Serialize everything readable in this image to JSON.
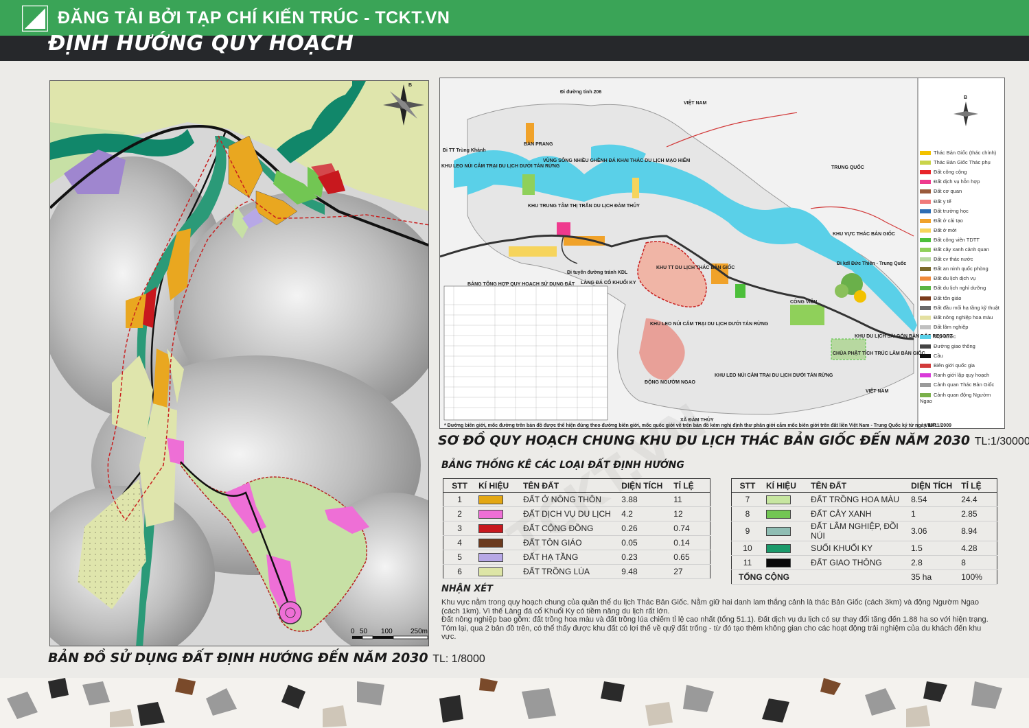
{
  "banner": {
    "text": "ĐĂNG TẢI BỞI TẠP CHÍ KIẾN TRÚC - TCKT.VN"
  },
  "page_title": "ĐỊNH HƯỚNG QUY HOẠCH",
  "left_map": {
    "caption": "BẢN ĐỒ SỬ DỤNG ĐẤT ĐỊNH HƯỚNG ĐẾN NĂM 2030",
    "scale_text": "TL: 1/8000",
    "north": "B",
    "scale_labels": [
      "0",
      "50",
      "100",
      "250m"
    ]
  },
  "right_map": {
    "caption": "SƠ ĐỒ QUY HOẠCH CHUNG KHU DU LỊCH THÁC BẢN GIỐC ĐẾN NĂM 2030",
    "scale_text": "TL:1/30000",
    "north": "B",
    "labels": {
      "road206": "Đi đường tỉnh 206",
      "vn1": "VIỆT NAM",
      "vn2": "VIỆT NAM",
      "cn": "TRUNG QUỐC",
      "trungkhanh": "Đi TT Trùng Khánh",
      "banprang": "BẢN PRANG",
      "zone1": "VÙNG SÔNG NHIỀU GHỀNH ĐÁ KHAI THÁC DU LỊCH MẠO HIỂM",
      "camp1": "KHU LEO NÚI CẮM TRẠI DU LỊCH DƯỚI TÁN RỪNG",
      "center": "KHU TRUNG TÂM THỊ TRẤN DU LỊCH ĐÀM THỦY",
      "thac": "KHU VỰC THÁC BẢN GIỐC",
      "ductien": "Đi kdl Đức Thiên - Trung Quốc",
      "khutt": "KHU TT DU LỊCH THÁC BẢN GIỐC",
      "congvien": "CÔNG VIÊN",
      "village": "LÀNG ĐÁ CỔ KHUỔI KY",
      "bypass": "Đi tuyến đường tránh KDL",
      "camp2": "KHU LEO NÚI CẮM TRẠI DU LỊCH DƯỚI TÁN RỪNG",
      "camp3": "KHU LEO NÚI CẮM TRẠI DU LỊCH DƯỚI TÁN RỪNG",
      "cave": "ĐỘNG NGƯỜM NGAO",
      "pagoda": "CHÙA PHẬT TÍCH TRÚC LÂM BẢN GIỐC",
      "resort": "KHU DU LỊCH SÀI GÒN BẢN ĐỐC RESORT",
      "xa": "XÃ ĐÀM THỦY",
      "table_title": "BẢNG TỔNG HỢP QUY HOẠCH SỬ DỤNG ĐẤT",
      "footnote": "* Đường biên giới, mốc đường trên bản đồ được thể hiện đúng theo đường biên giới, mốc quốc giới về trên bản đồ kèm nghị định thư phân giới cắm mốc biên giới trên đất liền Việt Nam - Trung Quốc ký từ ngày 18/11/2009",
      "logo": "VIUP"
    },
    "legend": [
      {
        "label": "Thác Bản Giốc (thác chính)",
        "color": "#f3c200"
      },
      {
        "label": "Thác Bản Giốc Thác phụ",
        "color": "#c9d44a"
      },
      {
        "label": "Đất công cộng",
        "color": "#e8242a"
      },
      {
        "label": "Đất dịch vụ hỗn hợp",
        "color": "#ef3a8e"
      },
      {
        "label": "Đất cơ quan",
        "color": "#9a5a3b"
      },
      {
        "label": "Đất y tế",
        "color": "#f07b7b"
      },
      {
        "label": "Đất trường học",
        "color": "#2d6db3"
      },
      {
        "label": "Đất ở cải tạo",
        "color": "#f0a22a"
      },
      {
        "label": "Đất ở mới",
        "color": "#f6d45c"
      },
      {
        "label": "Đất công viên TDTT",
        "color": "#4cbf3a"
      },
      {
        "label": "Đất cây xanh cảnh quan",
        "color": "#8fd05a"
      },
      {
        "label": "Đất cv thác nước",
        "color": "#b7d8a0"
      },
      {
        "label": "Đất an ninh quốc phòng",
        "color": "#7b6a2a"
      },
      {
        "label": "Đất du lịch dịch vụ",
        "color": "#f08a3a"
      },
      {
        "label": "Đất du lịch nghỉ dưỡng",
        "color": "#5bb544"
      },
      {
        "label": "Đất tôn giáo",
        "color": "#7a3a1a"
      },
      {
        "label": "Đất đầu mối hạ tầng kỹ thuật",
        "color": "#6a6a6a"
      },
      {
        "label": "Đất nông nghiệp hoa màu",
        "color": "#e4e0a0"
      },
      {
        "label": "Đất lâm nghiệp",
        "color": "#c0c0c0"
      },
      {
        "label": "Mặt nước",
        "color": "#5ad0e8"
      },
      {
        "label": "Đường giao thông",
        "color": "#444444"
      },
      {
        "label": "Cầu",
        "color": "#111111"
      },
      {
        "label": "Biên giới quốc gia",
        "color": "#d23a3a"
      },
      {
        "label": "Ranh giới lập quy hoạch",
        "color": "#d93ad9"
      },
      {
        "label": "Cảnh quan Thác Bản Giốc",
        "color": "#9a9a9a"
      },
      {
        "label": "Cảnh quan động Ngườm Ngao",
        "color": "#7ab04a"
      }
    ]
  },
  "stats": {
    "title": "BẢNG THỐNG KÊ CÁC LOẠI ĐẤT ĐỊNH HƯỚNG",
    "headers": [
      "STT",
      "KÍ HIỆU",
      "TÊN ĐẤT",
      "DIỆN TÍCH",
      "TỈ LỆ"
    ],
    "left_rows": [
      {
        "stt": "1",
        "name": "ĐẤT Ở NÔNG THÔN",
        "area": "3.88",
        "ratio": "11",
        "color": "#e3a713"
      },
      {
        "stt": "2",
        "name": "ĐẤT DỊCH VỤ DU LỊCH",
        "area": "4.2",
        "ratio": "12",
        "color": "#ee6fd6"
      },
      {
        "stt": "3",
        "name": "ĐẤT CỘNG ĐỒNG",
        "area": "0.26",
        "ratio": "0.74",
        "color": "#c8181e"
      },
      {
        "stt": "4",
        "name": "ĐẤT TÔN GIÁO",
        "area": "0.05",
        "ratio": "0.14",
        "color": "#6b3a1e"
      },
      {
        "stt": "5",
        "name": "ĐẤT HẠ TẦNG",
        "area": "0.23",
        "ratio": "0.65",
        "color": "#b7a8e6"
      },
      {
        "stt": "6",
        "name": "ĐẤT TRỒNG LÚA",
        "area": "9.48",
        "ratio": "27",
        "color": "#dde5a6"
      }
    ],
    "right_rows": [
      {
        "stt": "7",
        "name": "ĐẤT TRỒNG HOA MÀU",
        "area": "8.54",
        "ratio": "24.4",
        "color": "#c7e6a0"
      },
      {
        "stt": "8",
        "name": "ĐẤT CÂY XANH",
        "area": "1",
        "ratio": "2.85",
        "color": "#72c653"
      },
      {
        "stt": "9",
        "name": "ĐẤT LÂM NGHIỆP, ĐỒI NÚI",
        "area": "3.06",
        "ratio": "8.94",
        "color": "#8fbdb3"
      },
      {
        "stt": "10",
        "name": "SUỐI KHUỔI KY",
        "area": "1.5",
        "ratio": "4.28",
        "color": "#1a9a6a"
      },
      {
        "stt": "11",
        "name": "ĐẤT GIAO THÔNG",
        "area": "2.8",
        "ratio": "8",
        "color": "#0a0a0a"
      }
    ],
    "total_label": "TỔNG CỘNG",
    "total_area": "35 ha",
    "total_ratio": "100%"
  },
  "remarks": {
    "title": "NHẬN XÉT",
    "p1": "Khu vực nằm trong quy hoạch chung của quần thể du lịch Thác Bản Giốc. Nằm giữ hai danh lam thắng cảnh là thác Bản Giốc (cách 3km) và động Ngườm Ngao (cách 1km). Vì thế Làng đá cổ Khuổi Ky có tiềm năng du lịch rất lớn.",
    "p2": "Đất nông nghiệp bao gồm: đất trồng hoa màu và đất trồng lúa chiếm tỉ lệ cao nhất (tổng 51.1). Đất dịch vụ du lịch có sự thay đổi tăng đến 1.88 ha so với hiện trạng.",
    "p3": "Tóm lại, qua 2 bản đồ trên, có thể thấy được khu đất có lợi thế về quỹ đất trống - từ đó tạo thêm không gian cho các hoạt động trải nghiệm của du khách đến khu vực."
  },
  "watermark": "TCKT.VN"
}
